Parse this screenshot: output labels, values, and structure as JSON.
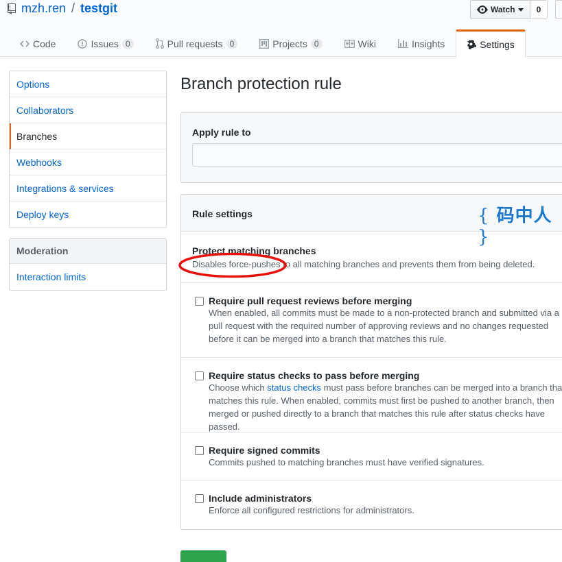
{
  "repo": {
    "owner": "mzh.ren",
    "separator": "/",
    "name": "testgit"
  },
  "watch": {
    "label": "Watch",
    "count": "0"
  },
  "tabs": [
    {
      "label": "Code",
      "counter": ""
    },
    {
      "label": "Issues",
      "counter": "0"
    },
    {
      "label": "Pull requests",
      "counter": "0"
    },
    {
      "label": "Projects",
      "counter": "0"
    },
    {
      "label": "Wiki",
      "counter": ""
    },
    {
      "label": "Insights",
      "counter": ""
    },
    {
      "label": "Settings",
      "counter": ""
    }
  ],
  "menu": {
    "items": [
      "Options",
      "Collaborators",
      "Branches",
      "Webhooks",
      "Integrations & services",
      "Deploy keys"
    ],
    "selected": "Branches"
  },
  "moderation": {
    "heading": "Moderation",
    "items": [
      "Interaction limits"
    ]
  },
  "page_title": "Branch protection rule",
  "apply": {
    "label": "Apply rule to",
    "value": ""
  },
  "rules": {
    "heading": "Rule settings",
    "watermark": {
      "open": "{",
      "text": "码中人",
      "close": "}"
    },
    "protect": {
      "title": "Protect matching branches",
      "desc": "Disables force-pushes to all matching branches and prevents them from being deleted."
    },
    "reviews": {
      "title": "Require pull request reviews before merging",
      "desc": "When enabled, all commits must be made to a non-protected branch and submitted via a pull request with the required number of approving reviews and no changes requested before it can be merged into a branch that matches this rule.",
      "checked": false
    },
    "status": {
      "title": "Require status checks to pass before merging",
      "desc_pre": "Choose which ",
      "desc_link": "status checks",
      "desc_post": " must pass before branches can be merged into a branch that matches this rule. When enabled, commits must first be pushed to another branch, then merged or pushed directly to a branch that matches this rule after status checks have passed.",
      "checked": false
    },
    "signed": {
      "title": "Require signed commits",
      "desc": "Commits pushed to matching branches must have verified signatures.",
      "checked": false
    },
    "admin": {
      "title": "Include administrators",
      "desc": "Enforce all configured restrictions for administrators.",
      "checked": false
    }
  },
  "colors": {
    "link": "#0366d6",
    "accent": "#e36209",
    "annotation": "#e8120c",
    "watermark": "#1a78d1",
    "primary_button": "#2ea44f"
  },
  "icons": [
    "repo-icon",
    "eye-icon",
    "caret-down-icon",
    "code-icon",
    "issue-icon",
    "pull-request-icon",
    "project-icon",
    "wiki-icon",
    "graph-icon",
    "gear-icon"
  ]
}
